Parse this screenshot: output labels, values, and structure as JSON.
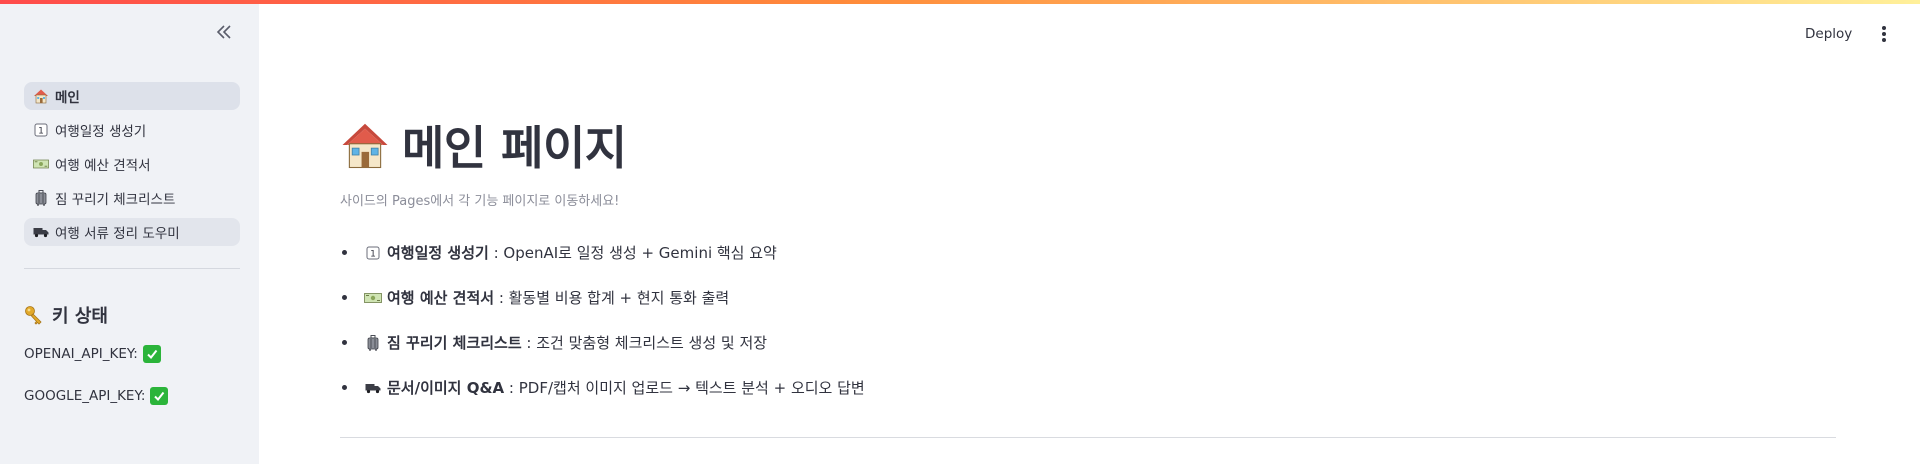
{
  "header": {
    "deploy_label": "Deploy"
  },
  "sidebar": {
    "nav": [
      {
        "icon": "house-icon",
        "label": "메인",
        "active": true
      },
      {
        "icon": "keycap-one-icon",
        "label": "여행일정 생성기"
      },
      {
        "icon": "money-icon",
        "label": "여행 예산 견적서"
      },
      {
        "icon": "luggage-icon",
        "label": "짐 꾸리기 체크리스트"
      },
      {
        "icon": "truck-icon",
        "label": "여행 서류 정리 도우미"
      }
    ],
    "key_section_title": "키 상태",
    "keys": [
      {
        "label": "OPENAI_API_KEY:",
        "status_icon": "check-mark-icon"
      },
      {
        "label": "GOOGLE_API_KEY:",
        "status_icon": "check-mark-icon"
      }
    ]
  },
  "main": {
    "title": "메인 페이지",
    "subtitle": "사이드의 Pages에서 각 기능 페이지로 이동하세요!",
    "features": [
      {
        "icon": "keycap-one-icon",
        "name": "여행일정 생성기",
        "desc": " : OpenAI로 일정 생성 + Gemini 핵심 요약"
      },
      {
        "icon": "money-icon",
        "name": "여행 예산 견적서",
        "desc": " : 활동별 비용 합계 + 현지 통화 출력"
      },
      {
        "icon": "luggage-icon",
        "name": "짐 꾸리기 체크리스트",
        "desc": " : 조건 맞춤형 체크리스트 생성 및 저장"
      },
      {
        "icon": "truck-icon",
        "name": "문서/이미지 Q&A",
        "desc": " : PDF/캡처 이미지 업로드 → 텍스트 분석 + 오디오 답변"
      }
    ]
  },
  "colors": {
    "sidebar_bg": "#f0f2f6",
    "active_item_bg": "#dde1ea",
    "text": "#31333f",
    "muted_text": "#8b8d99",
    "check_green": "#2bb43a",
    "accent_red": "#ff4b4b"
  }
}
